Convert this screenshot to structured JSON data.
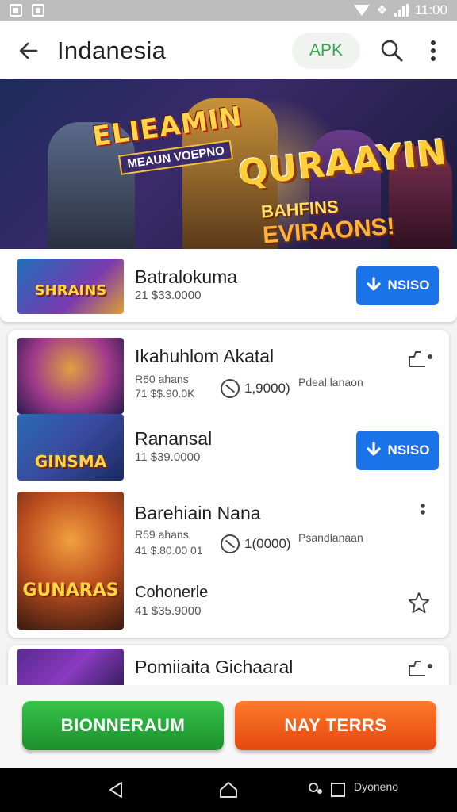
{
  "status_bar": {
    "time": "11:00"
  },
  "app_bar": {
    "title": "Indanesia",
    "apk_label": "APK"
  },
  "banner": {
    "title_left": "ELIEAMIN",
    "subtitle_left": "MEAUN VOEPNO",
    "title_right": "QURAAYIN",
    "tagline_prefix": "BAHFINS",
    "tagline_suffix": "EVIRAONS!"
  },
  "featured_app": {
    "name": "Batralokuma",
    "size": "21 $33.0000",
    "thumb_label": "SHRAINS",
    "install_label": "NSISO"
  },
  "apps": [
    {
      "name": "Ikahuhlom Akatal",
      "line1": "R60 ahans",
      "line2": "71 $$.90.0K",
      "rating": "1,9000)",
      "extra": "Pdeal lanaon"
    },
    {
      "name": "Ranansal",
      "line1": "11 $39.0000",
      "thumb_label": "GINSMA",
      "install_label": "NSISO"
    },
    {
      "name": "Barehiain Nana",
      "line1": "R59 ahans",
      "line2": "41 $.80.00 01",
      "rating": "1(0000)",
      "extra": "Psandlanaan",
      "thumb_label": "GUNARAS"
    },
    {
      "name": "Cohonerle",
      "line1": "41 $35.9000"
    },
    {
      "name": "Pomiiaita Gichaaral"
    }
  ],
  "actions": {
    "primary": "BIONNERAUM",
    "secondary": "NAY TERRS"
  },
  "nav_bar": {
    "extra_text": "Dyoneno"
  },
  "colors": {
    "install_blue": "#1a73e8",
    "green_button": "#2fb443",
    "orange_button": "#f05a1a",
    "apk_green": "#3aa655"
  }
}
